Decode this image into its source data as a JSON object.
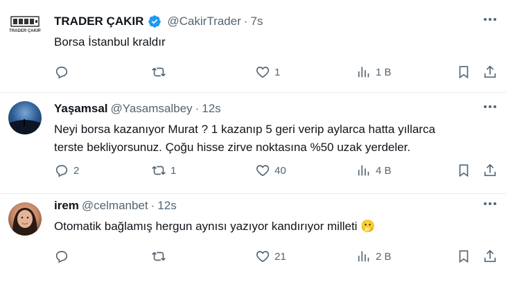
{
  "tweets": [
    {
      "name": "TRADER ÇAKIR",
      "handle": "@CakirTrader",
      "separator": "·",
      "time": "7s",
      "verified": true,
      "avatar_logo_text": "TRADER ÇAKIR",
      "text_lines": [
        "Borsa İstanbul kraldır"
      ],
      "replies": "",
      "reposts": "",
      "likes": "1",
      "views": "1 B"
    },
    {
      "name": "Yaşamsal",
      "handle": "@Yasamsalbey",
      "separator": "·",
      "time": "12s",
      "verified": false,
      "text_lines": [
        "Neyi borsa kazanıyor Murat ? 1 kazanıp 5 geri verip aylarca hatta yıllarca",
        "terste bekliyorsunuz. Çoğu hisse zirve noktasına %50 uzak yerdeler."
      ],
      "replies": "2",
      "reposts": "1",
      "likes": "40",
      "views": "4 B"
    },
    {
      "name": "irem",
      "handle": "@celmanbet",
      "separator": "·",
      "time": "12s",
      "verified": false,
      "text_lines": [
        "Otomatik bağlamış hergun aynısı yazıyor kandırıyor milleti 🫢"
      ],
      "replies": "",
      "reposts": "",
      "likes": "21",
      "views": "2 B"
    }
  ],
  "icons": {
    "reply": "reply-icon",
    "repost": "repost-icon",
    "like": "heart-icon",
    "views": "views-chart-icon",
    "bookmark": "bookmark-icon",
    "share": "share-icon",
    "verified": "verified-badge-icon",
    "more": "more-dots-icon"
  },
  "colors": {
    "text": "#0f1419",
    "muted": "#536471",
    "verified": "#1d9bf0",
    "divider": "#e6ecf0"
  }
}
